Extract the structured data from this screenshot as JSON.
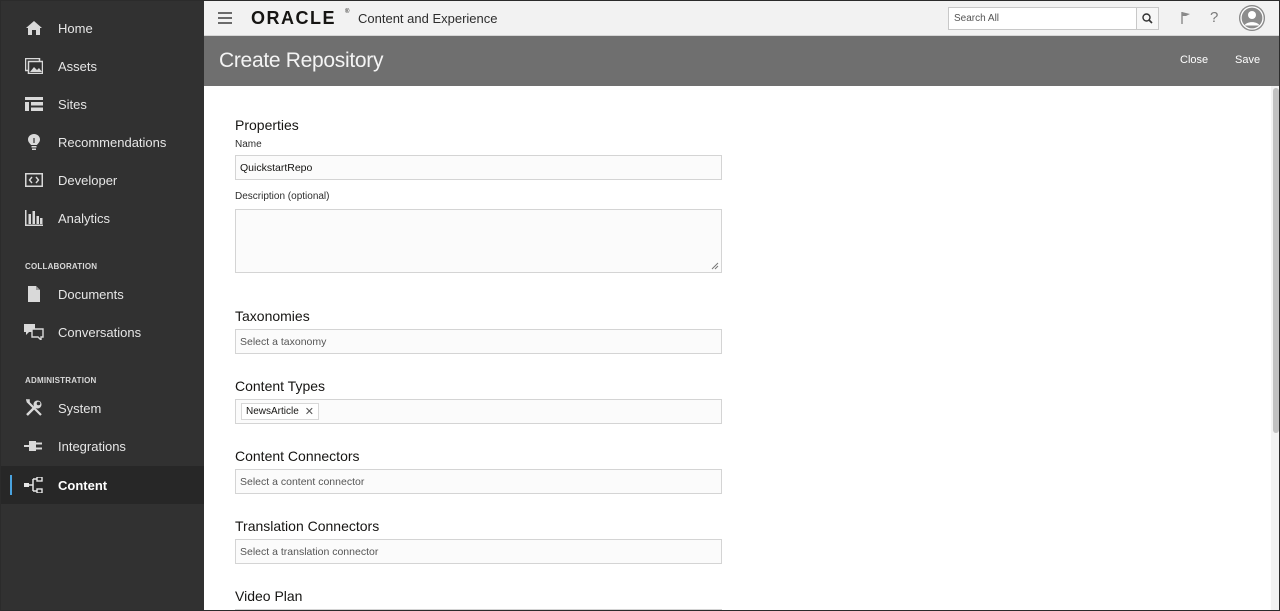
{
  "sidebar": {
    "items": [
      {
        "label": "Home",
        "icon": "home-icon"
      },
      {
        "label": "Assets",
        "icon": "assets-icon"
      },
      {
        "label": "Sites",
        "icon": "sites-icon"
      },
      {
        "label": "Recommendations",
        "icon": "lightbulb-icon"
      },
      {
        "label": "Developer",
        "icon": "developer-icon"
      },
      {
        "label": "Analytics",
        "icon": "analytics-icon"
      }
    ],
    "collaboration_label": "COLLABORATION",
    "collaboration_items": [
      {
        "label": "Documents",
        "icon": "documents-icon"
      },
      {
        "label": "Conversations",
        "icon": "conversations-icon"
      }
    ],
    "administration_label": "ADMINISTRATION",
    "administration_items": [
      {
        "label": "System",
        "icon": "system-tools-icon"
      },
      {
        "label": "Integrations",
        "icon": "integrations-plug-icon"
      },
      {
        "label": "Content",
        "icon": "content-hierarchy-icon",
        "active": true
      }
    ],
    "active_accent": "#4aa3df"
  },
  "topbar": {
    "logo": "ORACLE",
    "logo_mark": "®",
    "app_title": "Content and Experience",
    "search_placeholder": "Search All"
  },
  "header": {
    "title": "Create Repository",
    "close_label": "Close",
    "save_label": "Save"
  },
  "form": {
    "properties": {
      "title": "Properties",
      "name_label": "Name",
      "name_value": "QuickstartRepo",
      "description_label": "Description (optional)",
      "description_value": ""
    },
    "taxonomies": {
      "title": "Taxonomies",
      "placeholder": "Select a taxonomy"
    },
    "content_types": {
      "title": "Content Types",
      "chips": [
        "NewsArticle"
      ],
      "remove_glyph": "✕"
    },
    "content_connectors": {
      "title": "Content Connectors",
      "placeholder": "Select a content connector"
    },
    "translation_connectors": {
      "title": "Translation Connectors",
      "placeholder": "Select a translation connector"
    },
    "video_plan": {
      "title": "Video Plan"
    }
  }
}
